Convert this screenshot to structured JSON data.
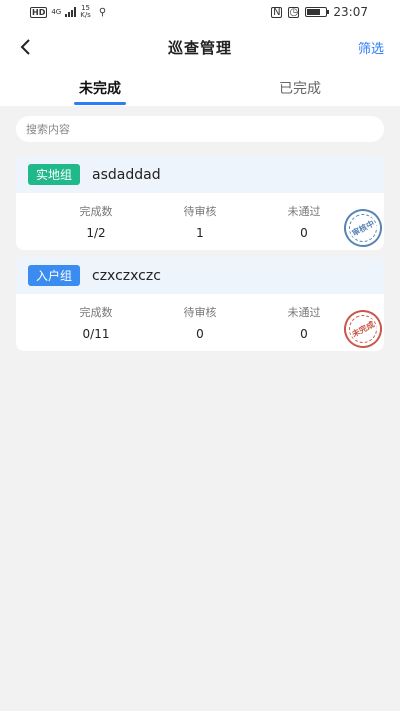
{
  "status_bar": {
    "hd_badge": "HD",
    "network": "4G",
    "speed_value": "15",
    "speed_unit": "K/s",
    "time": "23:07",
    "battery_level": 0.7
  },
  "nav": {
    "title": "巡查管理",
    "filter_label": "筛选"
  },
  "tabs": [
    {
      "label": "未完成",
      "active": true
    },
    {
      "label": "已完成",
      "active": false
    }
  ],
  "search": {
    "placeholder": "搜索内容",
    "value": ""
  },
  "cards": [
    {
      "tag": "实地组",
      "tag_color": "#21b98a",
      "name": "asdaddad",
      "stats": [
        {
          "label": "完成数",
          "value": "1/2"
        },
        {
          "label": "待审核",
          "value": "1"
        },
        {
          "label": "未通过",
          "value": "0"
        }
      ],
      "stamp": "审核中",
      "stamp_color": "#3a6fa8"
    },
    {
      "tag": "入户组",
      "tag_color": "#3b8cf0",
      "name": "czxczxczc",
      "stats": [
        {
          "label": "完成数",
          "value": "0/11"
        },
        {
          "label": "待审核",
          "value": "0"
        },
        {
          "label": "未通过",
          "value": "0"
        }
      ],
      "stamp": "未完成",
      "stamp_color": "#c0392b"
    }
  ],
  "colors": {
    "accent": "#2e7cf6",
    "background": "#f2f2f2"
  }
}
